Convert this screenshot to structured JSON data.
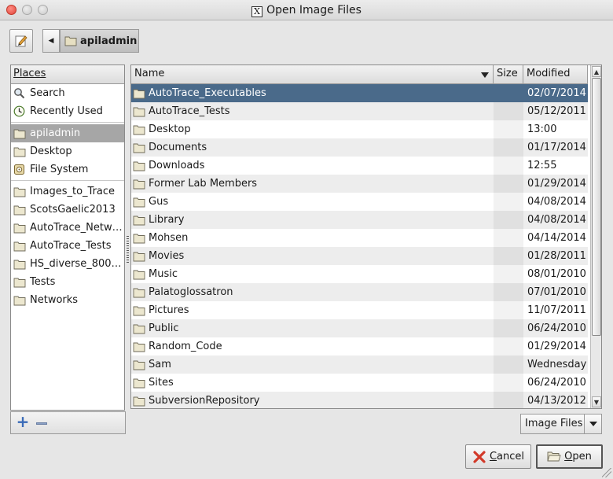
{
  "window": {
    "title": "Open Image Files"
  },
  "pathbar": {
    "current_folder": "apiladmin"
  },
  "places": {
    "header": "Places",
    "items": [
      {
        "label": "Search",
        "icon": "search-icon"
      },
      {
        "label": "Recently Used",
        "icon": "recent-icon"
      },
      {
        "label": "apiladmin",
        "icon": "folder-icon",
        "selected": true
      },
      {
        "label": "Desktop",
        "icon": "folder-icon"
      },
      {
        "label": "File System",
        "icon": "drive-icon"
      }
    ],
    "bookmarks": [
      {
        "label": "Images_to_Trace"
      },
      {
        "label": "ScotsGaelic2013"
      },
      {
        "label": "AutoTrace_Netw…"
      },
      {
        "label": "AutoTrace_Tests"
      },
      {
        "label": "HS_diverse_800…"
      },
      {
        "label": "Tests"
      },
      {
        "label": "Networks"
      }
    ]
  },
  "files": {
    "columns": {
      "name": "Name",
      "size": "Size",
      "modified": "Modified"
    },
    "rows": [
      {
        "name": "AutoTrace_Executables",
        "modified": "02/07/2014",
        "selected": true
      },
      {
        "name": "AutoTrace_Tests",
        "modified": "05/12/2011"
      },
      {
        "name": "Desktop",
        "modified": "13:00"
      },
      {
        "name": "Documents",
        "modified": "01/17/2014"
      },
      {
        "name": "Downloads",
        "modified": "12:55"
      },
      {
        "name": "Former Lab Members",
        "modified": "01/29/2014"
      },
      {
        "name": "Gus",
        "modified": "04/08/2014"
      },
      {
        "name": "Library",
        "modified": "04/08/2014"
      },
      {
        "name": "Mohsen",
        "modified": "04/14/2014"
      },
      {
        "name": "Movies",
        "modified": "01/28/2011"
      },
      {
        "name": "Music",
        "modified": "08/01/2010"
      },
      {
        "name": "Palatoglossatron",
        "modified": "07/01/2010"
      },
      {
        "name": "Pictures",
        "modified": "11/07/2011"
      },
      {
        "name": "Public",
        "modified": "06/24/2010"
      },
      {
        "name": "Random_Code",
        "modified": "01/29/2014"
      },
      {
        "name": "Sam",
        "modified": "Wednesday"
      },
      {
        "name": "Sites",
        "modified": "06/24/2010"
      },
      {
        "name": "SubversionRepository",
        "modified": "04/13/2012"
      }
    ]
  },
  "filter": {
    "selected": "Image Files"
  },
  "actions": {
    "cancel_label": "Cancel",
    "open_label": "Open"
  },
  "colors": {
    "selection": "#4a6a8a",
    "place_selection": "#a6a6a6",
    "folder": "#d9d0a8"
  }
}
